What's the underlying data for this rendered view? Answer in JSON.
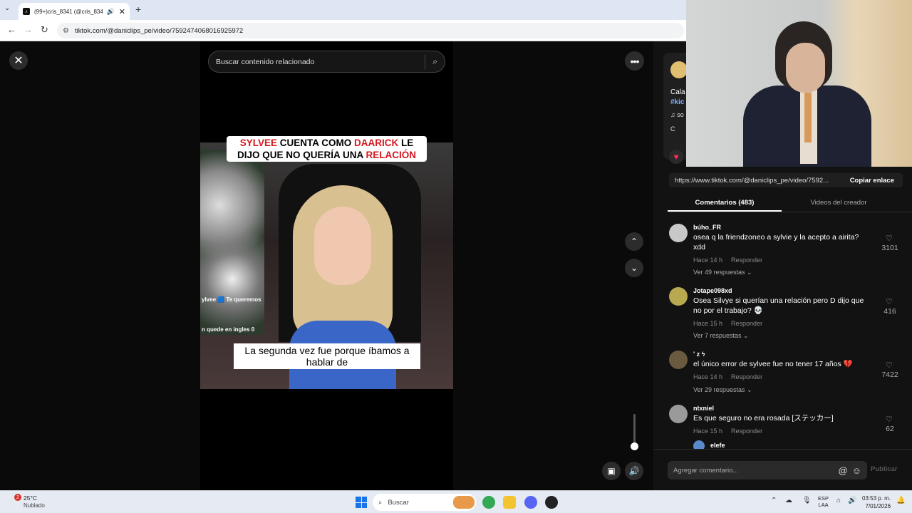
{
  "browser": {
    "tab_title": "(99+)cris_8341 (@cris_834",
    "url": "tiktok.com/@daniclips_pe/video/7592474068016925972"
  },
  "viewer": {
    "search_placeholder": "Buscar contenido relacionado",
    "caption_top_parts": [
      "SYLVEE",
      " CUENTA COMO ",
      "DAARICK",
      " LE DIJO QUE NO QUERÍA UNA ",
      "RELACIÓN"
    ],
    "caption_bottom": "La segunda vez fue porque íbamos a hablar de",
    "overlay_1": "ylvee 🟦 Te queremos",
    "overlay_2": "n quede en ingles 0",
    "volume_level": 0.1
  },
  "panel": {
    "creator_text": "Cala",
    "creator_tag": "#kic",
    "creator_sound": "♫ so",
    "creator_c": "C",
    "share_url": "https://www.tiktok.com/@daniclips_pe/video/7592...",
    "copy_label": "Copiar enlace",
    "tabs": [
      "Comentarios (483)",
      "Videos del creador"
    ],
    "comments": [
      {
        "user": "búho_FR",
        "text": "osea q la friendzoneo a sylvie y la acepto a airita? xdd",
        "time": "Hace 14 h",
        "reply": "Responder",
        "replies": "Ver 49 respuestas ⌄",
        "likes": "3101"
      },
      {
        "user": "Jotape098xd",
        "text": "Osea Silvye si querían una relación pero D dijo que no por el trabajo? 💀",
        "time": "Hace 15 h",
        "reply": "Responder",
        "replies": "Ver 7 respuestas ⌄",
        "likes": "416"
      },
      {
        "user": "' z ϟ",
        "text": "el único error de sylvee fue no tener 17 años 💔",
        "time": "Hace 14 h",
        "reply": "Responder",
        "replies": "Ver 29 respuestas ⌄",
        "likes": "7422"
      },
      {
        "user": "ntxniel",
        "text": "Es que seguro no era rosada [ステッカー]",
        "time": "Hace 15 h",
        "reply": "Responder",
        "replies": "",
        "likes": "62"
      }
    ],
    "next_user": "elefe",
    "comment_placeholder": "Agregar comentario...",
    "publish_label": "Publicar"
  },
  "taskbar": {
    "weather_badge": "2",
    "temp": "25°C",
    "condition": "Nublado",
    "search_label": "Buscar",
    "lang": "ESP",
    "lang_sub": "LAA",
    "time": "03:53 p. m.",
    "date": "7/01/2026"
  }
}
